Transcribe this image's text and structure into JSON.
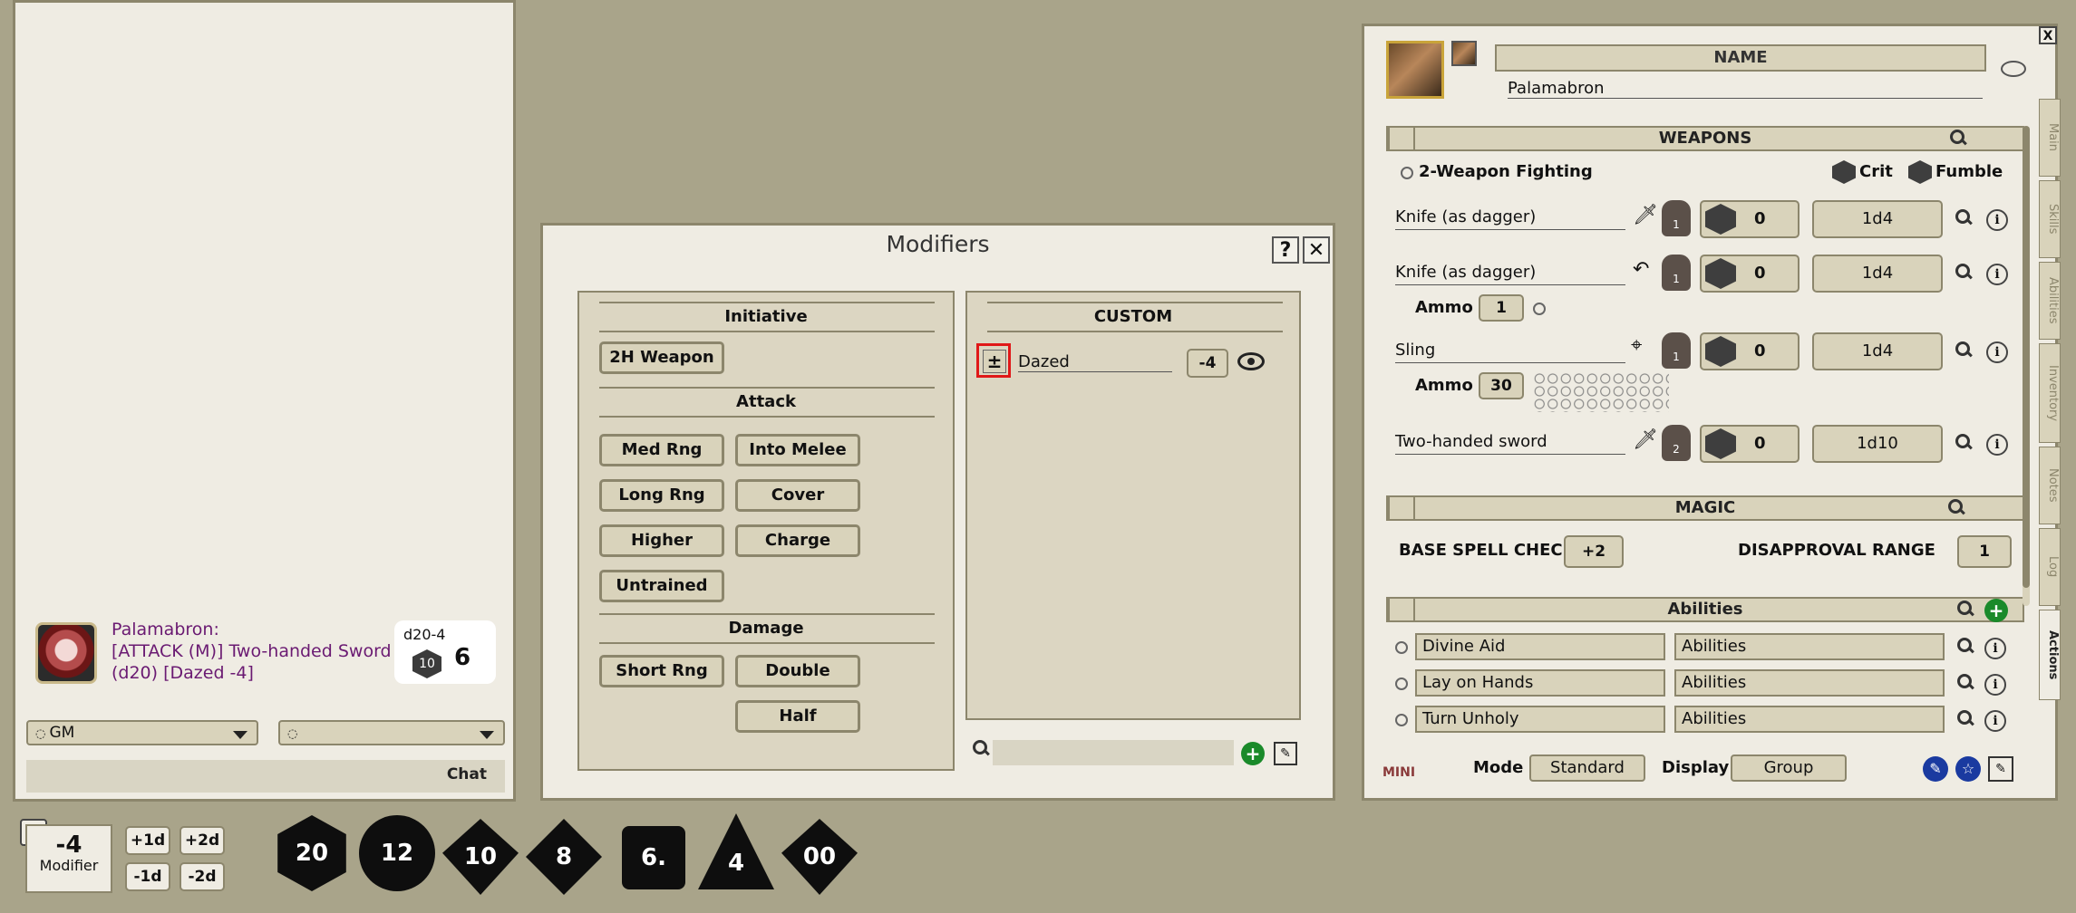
{
  "chat": {
    "sender": "Palamabron:",
    "message": "[ATTACK (M)] Two-handed Sword (d20) [Dazed -4]",
    "roll_label": "d20-4",
    "roll_die": "10",
    "roll_total": "6",
    "identity_select": "GM",
    "mode_select": "",
    "chat_label": "Chat"
  },
  "hotbar": {
    "modifier_value": "-4",
    "modifier_label": "Modifier",
    "buttons": [
      "+1d",
      "+2d",
      "-1d",
      "-2d"
    ],
    "dice": [
      "20",
      "12",
      "10",
      "8",
      "6.",
      "4",
      "00"
    ]
  },
  "modifiers": {
    "title": "Modifiers",
    "help": "?",
    "close": "✕",
    "sections": {
      "initiative": {
        "title": "Initiative",
        "buttons": [
          "2H Weapon"
        ]
      },
      "attack": {
        "title": "Attack",
        "buttons": [
          "Med Rng",
          "Into Melee",
          "Long Rng",
          "Cover",
          "Higher",
          "Charge",
          "Untrained"
        ]
      },
      "damage": {
        "title": "Damage",
        "buttons": [
          "Short Rng",
          "Double",
          "Half"
        ]
      }
    },
    "custom": {
      "title": "CUSTOM",
      "item_name": "Dazed",
      "item_value": "-4",
      "pm": "±"
    }
  },
  "sheet": {
    "name_label": "NAME",
    "name_value": "Palamabron",
    "weapons": {
      "title": "WEAPONS",
      "two_weapon": "2-Weapon Fighting",
      "crit": "Crit",
      "fumble": "Fumble",
      "ammo_label": "Ammo",
      "items": [
        {
          "name": "Knife (as dagger)",
          "hands": "1",
          "attack": "0",
          "damage": "1d4"
        },
        {
          "name": "Knife (as dagger)",
          "hands": "1",
          "attack": "0",
          "damage": "1d4",
          "ammo": "1"
        },
        {
          "name": "Sling",
          "hands": "1",
          "attack": "0",
          "damage": "1d4",
          "ammo": "30"
        },
        {
          "name": "Two-handed sword",
          "hands": "2",
          "attack": "0",
          "damage": "1d10"
        }
      ]
    },
    "magic": {
      "title": "MAGIC",
      "base_spell_check_label": "BASE SPELL CHECK",
      "base_spell_check_value": "+2",
      "disapproval_label": "DISAPPROVAL RANGE",
      "disapproval_value": "1"
    },
    "abilities": {
      "title": "Abilities",
      "items": [
        {
          "name": "Divine Aid",
          "type": "Abilities"
        },
        {
          "name": "Lay on Hands",
          "type": "Abilities"
        },
        {
          "name": "Turn Unholy",
          "type": "Abilities"
        }
      ]
    },
    "footer": {
      "mode_label": "Mode",
      "mode_value": "Standard",
      "display_label": "Display",
      "display_value": "Group",
      "mini": "MINI"
    },
    "tabs": [
      "Main",
      "Skills",
      "Abilities",
      "Inventory",
      "Notes",
      "Log",
      "Actions"
    ],
    "close": "X"
  }
}
